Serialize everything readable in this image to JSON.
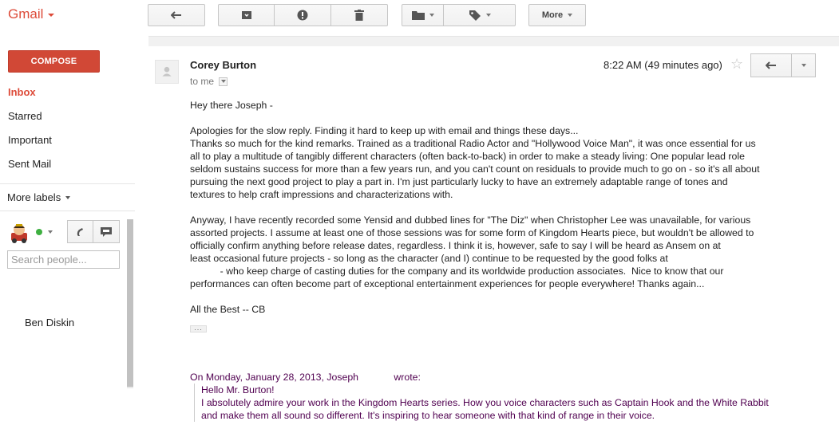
{
  "app": {
    "logo": "Gmail"
  },
  "toolbar": {
    "more_label": "More",
    "icons": [
      "back-arrow-icon",
      "archive-icon",
      "report-spam-icon",
      "trash-icon",
      "folder-icon",
      "label-tag-icon"
    ]
  },
  "nav": {
    "compose_label": "COMPOSE",
    "items": [
      {
        "label": "Inbox",
        "active": true
      },
      {
        "label": "Starred"
      },
      {
        "label": "Important"
      },
      {
        "label": "Sent Mail"
      }
    ],
    "more_labels": "More labels"
  },
  "chat": {
    "search_placeholder": "Search people...",
    "status_color": "#3eb041",
    "contacts": [
      "Ben Diskin"
    ]
  },
  "message": {
    "sender": "Corey Burton",
    "to": "to me",
    "time": "8:22 AM (49 minutes ago)",
    "body": [
      "Hey there Joseph -",
      "",
      "Apologies for the slow reply.  Finding it hard to keep up with email and things these days...",
      "Thanks so much for the kind remarks.  Trained as a traditional Radio Actor and \"Hollywood Voice Man\", it was once essential for us",
      "all to play a multitude of tangibly different characters (often back-to-back) in order to make a steady living:  One popular lead role",
      "seldom sustains success for more than a few years run, and you can't count on residuals to provide much to go on - so it's all about",
      "pursuing the next good project to play a part in.  I'm just particularly lucky to have an extremely adaptable range of tones and",
      "textures to help craft impressions and characterizations with.",
      "",
      "Anyway, I have recently recorded some Yensid and dubbed lines for \"The Diz\" when Christopher Lee was unavailable, for various",
      "assorted projects.  I assume at least one of those sessions was for some form of Kingdom Hearts piece, but wouldn't be allowed to",
      "officially confirm anything before release dates, regardless.  I think it is, however, safe to say I will be heard as Ansem on at",
      "least occasional future projects - so long as the character (and I) continue to be requested by the good folks at",
      "           - who keep charge of casting duties for the company and its worldwide production associates.  Nice to know that our",
      "performances can often become part of exceptional entertainment experiences for people everywhere!  Thanks again...",
      "",
      "All the Best  -- CB"
    ],
    "quoted_header": "On Monday, January 28, 2013, Joseph             wrote:",
    "quoted": [
      "Hello Mr. Burton!",
      "I absolutely admire your work in the Kingdom Hearts series. How you voice characters such as Captain Hook and the White Rabbit",
      "and make them all sound so different. It's inspiring to hear someone with that kind of range in their voice."
    ]
  },
  "colors": {
    "brand": "#dd4b39",
    "compose": "#d14836",
    "quote": "#500050"
  }
}
